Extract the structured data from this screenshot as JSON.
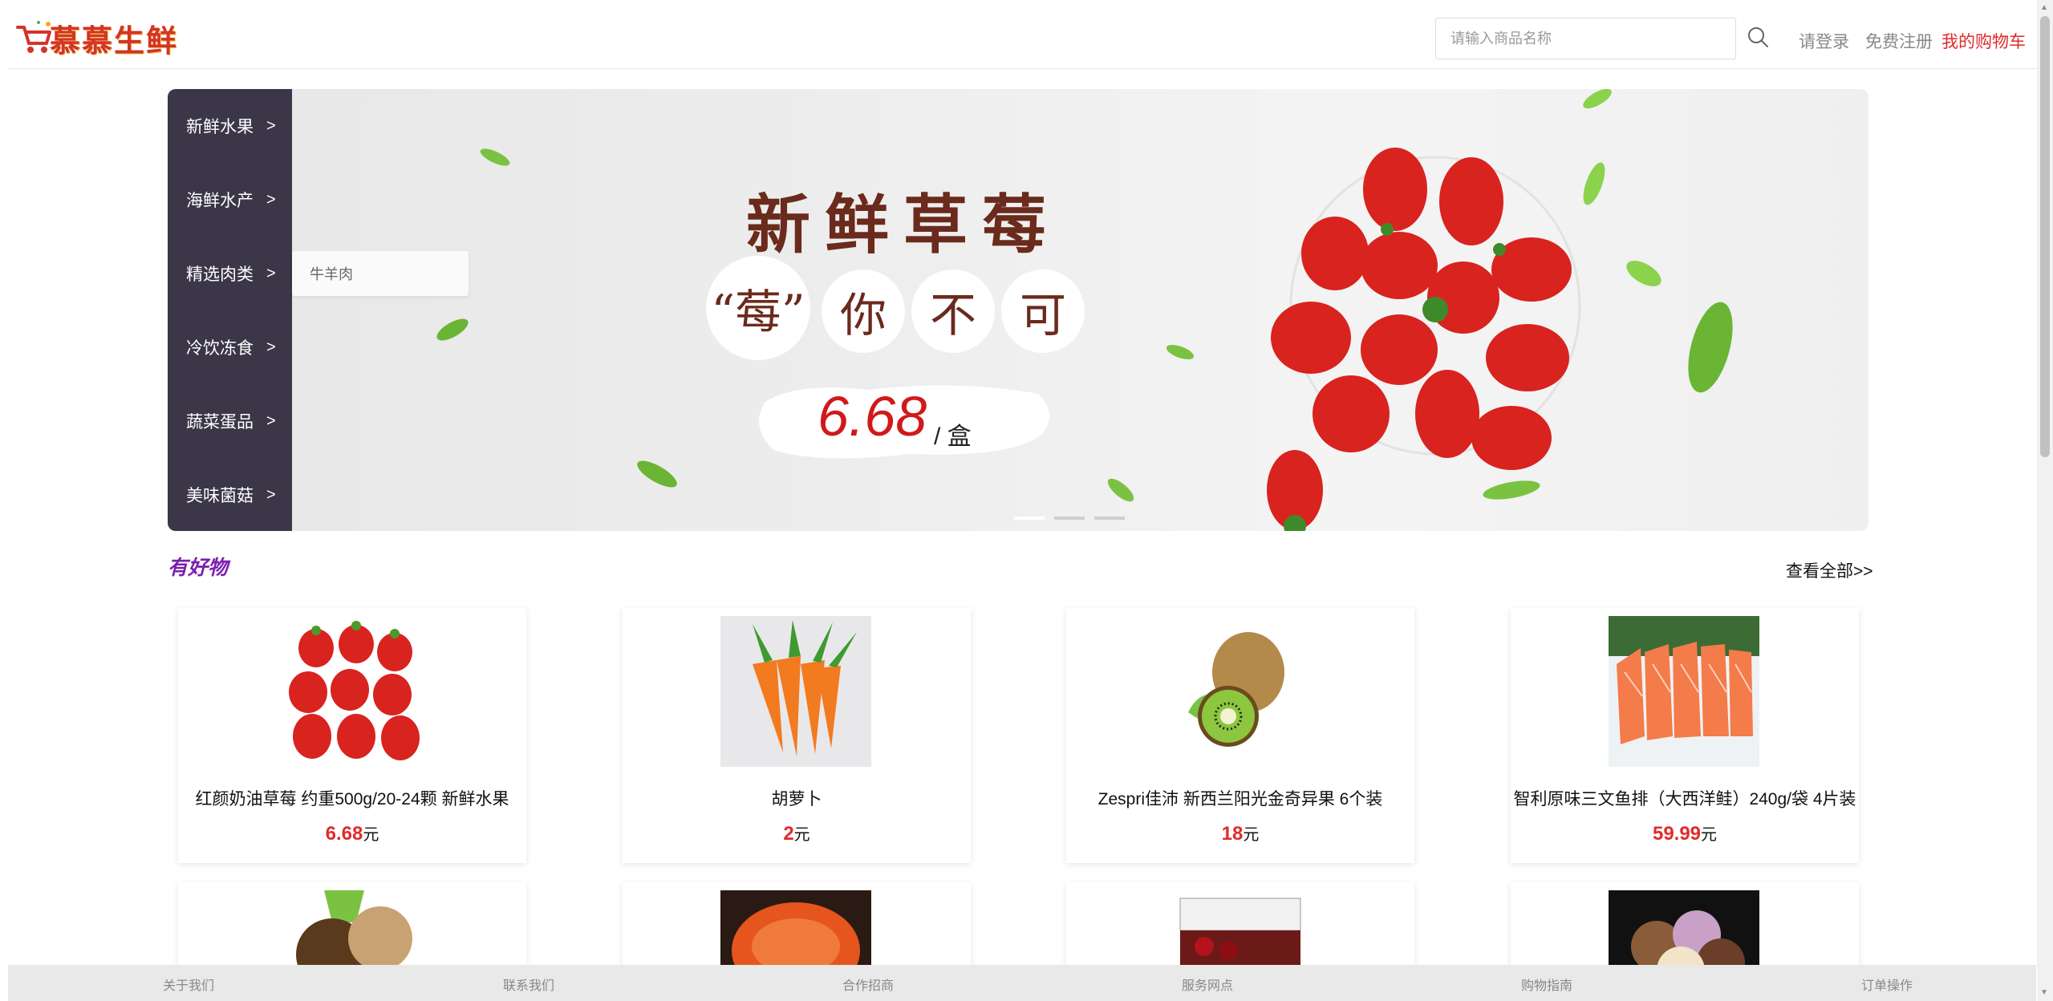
{
  "header": {
    "logo_text": "慕慕生鲜",
    "search_placeholder": "请输入商品名称",
    "login": "请登录",
    "register": "免费注册",
    "cart": "我的购物车"
  },
  "categories": [
    {
      "label": "新鲜水果",
      "arrow": ">"
    },
    {
      "label": "海鲜水产",
      "arrow": ">"
    },
    {
      "label": "精选肉类",
      "arrow": ">"
    },
    {
      "label": "冷饮冻食",
      "arrow": ">"
    },
    {
      "label": "蔬菜蛋品",
      "arrow": ">"
    },
    {
      "label": "美味菌菇",
      "arrow": ">"
    }
  ],
  "submenu": {
    "item": "牛羊肉"
  },
  "banner": {
    "title": "新鲜草莓",
    "slogan": [
      "“莓”",
      "你",
      "不",
      "可"
    ],
    "price": "6.68",
    "unit": "/ 盒",
    "slide_count": 3,
    "active_slide": 1
  },
  "section": {
    "title": "有好物",
    "view_all": "查看全部>>"
  },
  "products": [
    {
      "name": "红颜奶油草莓 约重500g/20-24颗 新鲜水果",
      "price": "6.68",
      "currency": "元",
      "icon": "strawberry-image"
    },
    {
      "name": "胡萝卜",
      "price": "2",
      "currency": "元",
      "icon": "carrot-image"
    },
    {
      "name": "Zespri佳沛 新西兰阳光金奇异果 6个装",
      "price": "18",
      "currency": "元",
      "icon": "kiwi-image"
    },
    {
      "name": "智利原味三文鱼排（大西洋鲑）240g/袋 4片装",
      "price": "59.99",
      "currency": "元",
      "icon": "salmon-image"
    }
  ],
  "partial_products": [
    {
      "icon": "mushroom-image"
    },
    {
      "icon": "crab-image"
    },
    {
      "icon": "cherry-box-image"
    },
    {
      "icon": "ice-cream-image"
    }
  ],
  "footer": {
    "links": [
      "关于我们",
      "联系我们",
      "合作招商",
      "服务网点",
      "购物指南",
      "订单操作"
    ]
  },
  "colors": {
    "accent_red": "#e02b2b",
    "menu_bg": "#3b3648",
    "section_title": "#7a1fae"
  }
}
